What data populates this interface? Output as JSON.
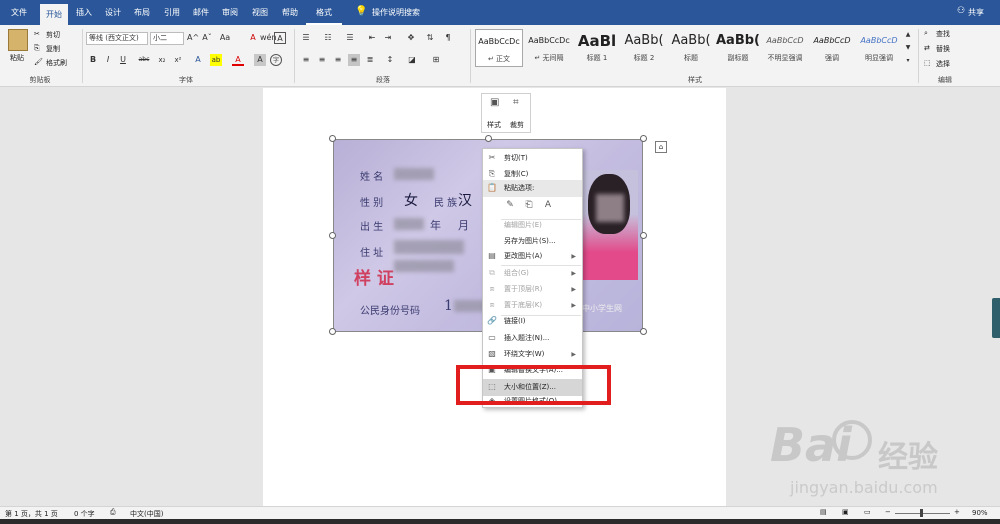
{
  "tabs": [
    "文件",
    "开始",
    "插入",
    "设计",
    "布局",
    "引用",
    "邮件",
    "审阅",
    "视图",
    "帮助",
    "格式"
  ],
  "tell_me": "操作说明搜索",
  "share": "共享",
  "clipboard": {
    "paste": "粘贴",
    "cut": "剪切",
    "copy": "复制",
    "painter": "格式刷",
    "group": "剪贴板"
  },
  "font": {
    "name": "等线 (西文正文)",
    "size": "小二",
    "group": "字体",
    "bold": "B",
    "italic": "I",
    "underline": "U",
    "strike": "abc",
    "sub": "x₂",
    "sup": "x²",
    "grow": "A^",
    "shrink": "Aˇ",
    "case": "Aa",
    "clear": "A",
    "pinyin": "wén",
    "border": "A",
    "highlight": "ab",
    "color": "A",
    "shade": "A",
    "circle": "字"
  },
  "paragraph": {
    "group": "段落"
  },
  "styles": {
    "group": "样式",
    "items": [
      {
        "preview": "AaBbCcDc",
        "name": "↵ 正文"
      },
      {
        "preview": "AaBbCcDc",
        "name": "↵ 无间隔"
      },
      {
        "preview": "AaBl",
        "name": "标题 1"
      },
      {
        "preview": "AaBb(",
        "name": "标题 2"
      },
      {
        "preview": "AaBb(",
        "name": "标题"
      },
      {
        "preview": "AaBb(",
        "name": "副标题"
      },
      {
        "preview": "AaBbCcD",
        "name": "不明显强调"
      },
      {
        "preview": "AaBbCcD",
        "name": "强调"
      },
      {
        "preview": "AaBbCcD",
        "name": "明显强调"
      }
    ]
  },
  "editing": {
    "find": "查找",
    "replace": "替换",
    "select": "选择",
    "group": "编辑"
  },
  "float_toolbar": {
    "style": "样式",
    "crop": "裁剪"
  },
  "idcard": {
    "name": "姓 名",
    "sex": "性 别",
    "sex_val": "女",
    "nation": "民 族",
    "nation_val": "汉",
    "birth": "出 生",
    "year": "年",
    "month": "月",
    "address": "住 址",
    "stamp": "样 证",
    "idno": "公民身份号码",
    "idno_val": "1",
    "watermark": "中小学生网"
  },
  "menu": [
    {
      "label": "剪切(T)",
      "icon": "scissors-icon",
      "disabled": false
    },
    {
      "label": "复制(C)",
      "icon": "copy-icon",
      "disabled": false
    },
    {
      "label": "粘贴选项:",
      "icon": "paste-icon",
      "disabled": false
    },
    {
      "label": "编辑图片(E)",
      "icon": "",
      "disabled": true
    },
    {
      "label": "另存为图片(S)...",
      "icon": "",
      "disabled": false
    },
    {
      "label": "更改图片(A)",
      "icon": "change-picture-icon",
      "disabled": false
    },
    {
      "label": "组合(G)",
      "icon": "group-icon",
      "disabled": true
    },
    {
      "label": "置于顶层(R)",
      "icon": "bring-front-icon",
      "disabled": true
    },
    {
      "label": "置于底层(K)",
      "icon": "send-back-icon",
      "disabled": true
    },
    {
      "label": "链接(I)",
      "icon": "link-icon",
      "disabled": false
    },
    {
      "label": "插入题注(N)...",
      "icon": "caption-icon",
      "disabled": false
    },
    {
      "label": "环绕文字(W)",
      "icon": "wrap-icon",
      "disabled": false
    },
    {
      "label": "编辑替换文字(A)...",
      "icon": "alt-text-icon",
      "disabled": false
    },
    {
      "label": "大小和位置(Z)...",
      "icon": "size-icon",
      "disabled": false
    },
    {
      "label": "设置图片格式(O)...",
      "icon": "format-icon",
      "disabled": false
    }
  ],
  "status": {
    "page": "第 1 页，共 1 页",
    "words": "0 个字",
    "lang": "中文(中国)",
    "zoom": "90%"
  },
  "watermark": {
    "brand": "Bai",
    "brand2": "经验",
    "url": "jingyan.baidu.com"
  }
}
